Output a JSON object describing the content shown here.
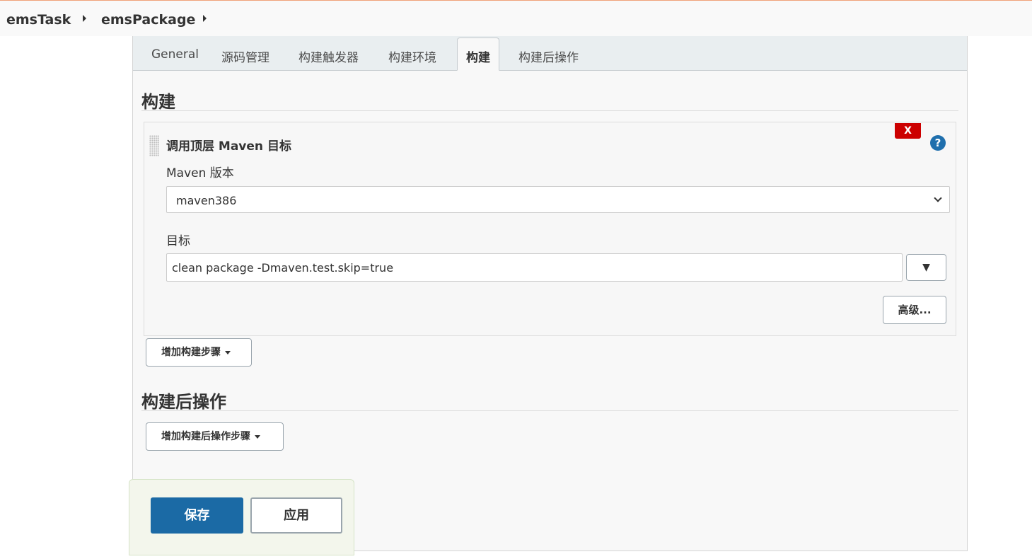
{
  "breadcrumb": {
    "items": [
      "emsTask",
      "emsPackage"
    ]
  },
  "tabs": [
    {
      "label": "General"
    },
    {
      "label": "源码管理"
    },
    {
      "label": "构建触发器"
    },
    {
      "label": "构建环境"
    },
    {
      "label": "构建",
      "active": true
    },
    {
      "label": "构建后操作"
    }
  ],
  "build": {
    "section_title": "构建",
    "step": {
      "title": "调用顶层 Maven 目标",
      "delete_label": "X",
      "help_label": "?",
      "maven_version_label": "Maven 版本",
      "maven_version_value": "maven386",
      "goals_label": "目标",
      "goals_value": "clean package -Dmaven.test.skip=true",
      "expand_label": "▼",
      "advanced_label": "高级..."
    },
    "add_step_label": "增加构建步骤"
  },
  "post_build": {
    "section_title": "构建后操作",
    "add_step_label": "增加构建后操作步骤"
  },
  "actions": {
    "save_label": "保存",
    "apply_label": "应用"
  },
  "colors": {
    "primary": "#1b6aa5",
    "delete": "#cc0000",
    "help": "#1f6fad"
  }
}
